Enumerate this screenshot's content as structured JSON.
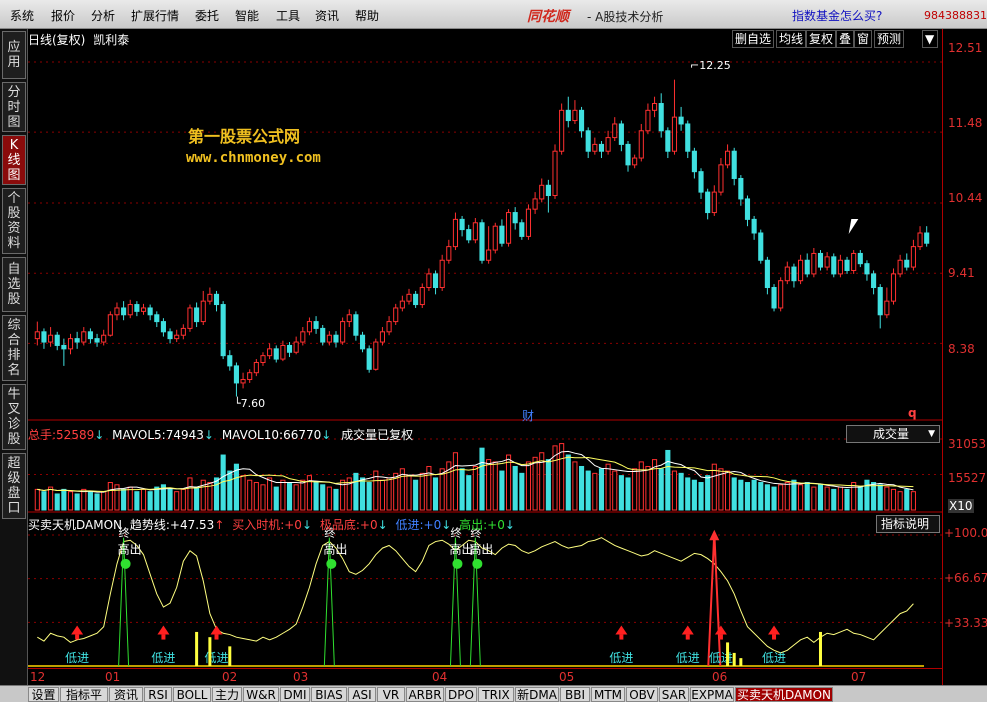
{
  "menu": [
    "系统",
    "报价",
    "分析",
    "扩展行情",
    "委托",
    "智能",
    "工具",
    "资讯",
    "帮助"
  ],
  "brand": "同花顺",
  "app_title": "- A股技术分析",
  "ad_link": "指数基金怎么买?",
  "phone": "984388831",
  "sidebar": [
    {
      "label": "应用",
      "active": false
    },
    {
      "label": "分时图",
      "active": false
    },
    {
      "label": "K线图",
      "active": true
    },
    {
      "label": "个股资料",
      "active": false
    },
    {
      "label": "自选股",
      "active": false
    },
    {
      "label": "综合排名",
      "active": false
    },
    {
      "label": "牛叉诊股",
      "active": false
    },
    {
      "label": "超级盘口",
      "active": false
    }
  ],
  "kline": {
    "period": "日线(复权)",
    "stock": "凯利泰",
    "tools": [
      "删自选",
      "均线",
      "复权",
      "叠",
      "窗",
      "预测"
    ],
    "watermark_cn": "第一股票公式网",
    "watermark_url": "www.chnmoney.com",
    "high_label": "12.25",
    "low_label": "7.60",
    "event_marker": "财",
    "q_marker": "q",
    "axis": [
      "12.51",
      "11.48",
      "10.44",
      "9.41",
      "8.38"
    ],
    "ylim": [
      7.3,
      12.7
    ],
    "colors": {
      "up": "#ff3030",
      "down": "#40e0e0",
      "grid": "#8b0000"
    }
  },
  "volume": {
    "total_label": "总手:",
    "total_value": "52589",
    "mavol5_label": "MAVOL5:",
    "mavol5_value": "74943",
    "mavol10_label": "MAVOL10:",
    "mavol10_value": "66770",
    "note": "成交量已复权",
    "selector": "成交量",
    "axis": [
      "31053",
      "15527",
      "X10"
    ]
  },
  "indicator": {
    "name": "买卖天机DAMON",
    "trend_label": "趋势线:",
    "trend_value": "+47.53",
    "buy_label": "买入时机:",
    "buy_value": "+0",
    "bottom_label": "极品底:",
    "bottom_value": "+0",
    "low_label": "低进:",
    "low_value": "+0",
    "high_label": "高出:",
    "high_value": "+0",
    "button": "指标说明",
    "axis": [
      "+100.0",
      "+66.67",
      "+33.33"
    ],
    "sell_text": "高出",
    "top_text": "终",
    "buy_text": "低进"
  },
  "dates": [
    "12",
    "01",
    "02",
    "03",
    "04",
    "05",
    "06",
    "07"
  ],
  "bottom_tabs": [
    "设置",
    "指标平台",
    "资讯",
    "RSI",
    "BOLL",
    "主力",
    "W&R",
    "DMI",
    "BIAS",
    "ASI",
    "VR",
    "ARBR",
    "DPO",
    "TRIX",
    "新DMA",
    "BBI",
    "MTM",
    "OBV",
    "SAR",
    "EXPMA",
    "买卖天机DAMON"
  ],
  "chart_data": {
    "type": "candlestick",
    "series": [
      {
        "o": 8.45,
        "c": 8.55,
        "h": 8.7,
        "l": 8.35
      },
      {
        "o": 8.55,
        "c": 8.4,
        "h": 8.6,
        "l": 8.3
      },
      {
        "o": 8.4,
        "c": 8.5,
        "h": 8.62,
        "l": 8.33
      },
      {
        "o": 8.5,
        "c": 8.35,
        "h": 8.55,
        "l": 8.28
      },
      {
        "o": 8.35,
        "c": 8.3,
        "h": 8.45,
        "l": 8.05
      },
      {
        "o": 8.3,
        "c": 8.45,
        "h": 8.52,
        "l": 8.22
      },
      {
        "o": 8.45,
        "c": 8.4,
        "h": 8.55,
        "l": 8.3
      },
      {
        "o": 8.4,
        "c": 8.55,
        "h": 8.62,
        "l": 8.35
      },
      {
        "o": 8.55,
        "c": 8.45,
        "h": 8.6,
        "l": 8.38
      },
      {
        "o": 8.45,
        "c": 8.4,
        "h": 8.52,
        "l": 8.33
      },
      {
        "o": 8.4,
        "c": 8.5,
        "h": 8.58,
        "l": 8.35
      },
      {
        "o": 8.5,
        "c": 8.8,
        "h": 8.85,
        "l": 8.48
      },
      {
        "o": 8.8,
        "c": 8.9,
        "h": 8.98,
        "l": 8.72
      },
      {
        "o": 8.9,
        "c": 8.8,
        "h": 9.0,
        "l": 8.72
      },
      {
        "o": 8.8,
        "c": 8.95,
        "h": 9.02,
        "l": 8.75
      },
      {
        "o": 8.95,
        "c": 8.85,
        "h": 9.0,
        "l": 8.78
      },
      {
        "o": 8.85,
        "c": 8.9,
        "h": 8.96,
        "l": 8.8
      },
      {
        "o": 8.9,
        "c": 8.8,
        "h": 8.95,
        "l": 8.72
      },
      {
        "o": 8.8,
        "c": 8.7,
        "h": 8.85,
        "l": 8.62
      },
      {
        "o": 8.7,
        "c": 8.55,
        "h": 8.75,
        "l": 8.48
      },
      {
        "o": 8.55,
        "c": 8.45,
        "h": 8.6,
        "l": 8.38
      },
      {
        "o": 8.45,
        "c": 8.5,
        "h": 8.58,
        "l": 8.4
      },
      {
        "o": 8.5,
        "c": 8.6,
        "h": 8.66,
        "l": 8.44
      },
      {
        "o": 8.6,
        "c": 8.9,
        "h": 8.95,
        "l": 8.55
      },
      {
        "o": 8.9,
        "c": 8.7,
        "h": 8.98,
        "l": 8.62
      },
      {
        "o": 8.7,
        "c": 9.0,
        "h": 9.15,
        "l": 8.65
      },
      {
        "o": 9.0,
        "c": 9.1,
        "h": 9.2,
        "l": 8.95
      },
      {
        "o": 9.1,
        "c": 8.95,
        "h": 9.15,
        "l": 8.85
      },
      {
        "o": 8.95,
        "c": 8.2,
        "h": 9.0,
        "l": 8.15
      },
      {
        "o": 8.2,
        "c": 8.05,
        "h": 8.28,
        "l": 7.98
      },
      {
        "o": 8.05,
        "c": 7.8,
        "h": 8.1,
        "l": 7.6
      },
      {
        "o": 7.8,
        "c": 7.85,
        "h": 7.95,
        "l": 7.72
      },
      {
        "o": 7.85,
        "c": 7.95,
        "h": 8.0,
        "l": 7.8
      },
      {
        "o": 7.95,
        "c": 8.1,
        "h": 8.15,
        "l": 7.9
      },
      {
        "o": 8.1,
        "c": 8.2,
        "h": 8.25,
        "l": 8.05
      },
      {
        "o": 8.2,
        "c": 8.3,
        "h": 8.38,
        "l": 8.15
      },
      {
        "o": 8.3,
        "c": 8.15,
        "h": 8.35,
        "l": 8.1
      },
      {
        "o": 8.15,
        "c": 8.35,
        "h": 8.42,
        "l": 8.12
      },
      {
        "o": 8.35,
        "c": 8.25,
        "h": 8.4,
        "l": 8.18
      },
      {
        "o": 8.25,
        "c": 8.4,
        "h": 8.48,
        "l": 8.22
      },
      {
        "o": 8.4,
        "c": 8.55,
        "h": 8.62,
        "l": 8.35
      },
      {
        "o": 8.55,
        "c": 8.7,
        "h": 8.76,
        "l": 8.5
      },
      {
        "o": 8.7,
        "c": 8.6,
        "h": 8.78,
        "l": 8.52
      },
      {
        "o": 8.6,
        "c": 8.4,
        "h": 8.65,
        "l": 8.35
      },
      {
        "o": 8.4,
        "c": 8.5,
        "h": 8.56,
        "l": 8.35
      },
      {
        "o": 8.5,
        "c": 8.4,
        "h": 8.56,
        "l": 8.32
      },
      {
        "o": 8.4,
        "c": 8.7,
        "h": 8.76,
        "l": 8.36
      },
      {
        "o": 8.7,
        "c": 8.8,
        "h": 8.88,
        "l": 8.62
      },
      {
        "o": 8.8,
        "c": 8.5,
        "h": 8.85,
        "l": 8.42
      },
      {
        "o": 8.5,
        "c": 8.3,
        "h": 8.55,
        "l": 8.25
      },
      {
        "o": 8.3,
        "c": 8.0,
        "h": 8.35,
        "l": 7.95
      },
      {
        "o": 8.0,
        "c": 8.4,
        "h": 8.45,
        "l": 7.98
      },
      {
        "o": 8.4,
        "c": 8.55,
        "h": 8.62,
        "l": 8.35
      },
      {
        "o": 8.55,
        "c": 8.7,
        "h": 8.78,
        "l": 8.5
      },
      {
        "o": 8.7,
        "c": 8.9,
        "h": 8.96,
        "l": 8.65
      },
      {
        "o": 8.9,
        "c": 9.0,
        "h": 9.08,
        "l": 8.85
      },
      {
        "o": 9.0,
        "c": 9.1,
        "h": 9.18,
        "l": 8.95
      },
      {
        "o": 9.1,
        "c": 8.95,
        "h": 9.15,
        "l": 8.9
      },
      {
        "o": 8.95,
        "c": 9.2,
        "h": 9.26,
        "l": 8.9
      },
      {
        "o": 9.2,
        "c": 9.4,
        "h": 9.48,
        "l": 9.15
      },
      {
        "o": 9.4,
        "c": 9.2,
        "h": 9.45,
        "l": 9.1
      },
      {
        "o": 9.2,
        "c": 9.6,
        "h": 9.68,
        "l": 9.15
      },
      {
        "o": 9.6,
        "c": 9.8,
        "h": 9.9,
        "l": 9.55
      },
      {
        "o": 9.8,
        "c": 10.2,
        "h": 10.3,
        "l": 9.75
      },
      {
        "o": 10.2,
        "c": 10.05,
        "h": 10.25,
        "l": 9.95
      },
      {
        "o": 10.05,
        "c": 9.9,
        "h": 10.12,
        "l": 9.85
      },
      {
        "o": 9.9,
        "c": 10.15,
        "h": 10.22,
        "l": 9.85
      },
      {
        "o": 10.15,
        "c": 9.6,
        "h": 10.2,
        "l": 9.55
      },
      {
        "o": 9.6,
        "c": 9.75,
        "h": 10.1,
        "l": 9.55
      },
      {
        "o": 9.75,
        "c": 10.1,
        "h": 10.15,
        "l": 9.7
      },
      {
        "o": 10.1,
        "c": 9.85,
        "h": 10.2,
        "l": 9.8
      },
      {
        "o": 9.85,
        "c": 10.3,
        "h": 10.35,
        "l": 9.8
      },
      {
        "o": 10.3,
        "c": 10.15,
        "h": 10.38,
        "l": 10.05
      },
      {
        "o": 10.15,
        "c": 9.95,
        "h": 10.2,
        "l": 9.9
      },
      {
        "o": 9.95,
        "c": 10.35,
        "h": 10.42,
        "l": 9.9
      },
      {
        "o": 10.35,
        "c": 10.5,
        "h": 10.6,
        "l": 10.28
      },
      {
        "o": 10.5,
        "c": 10.7,
        "h": 10.8,
        "l": 10.45
      },
      {
        "o": 10.7,
        "c": 10.55,
        "h": 10.78,
        "l": 10.3
      },
      {
        "o": 10.55,
        "c": 11.2,
        "h": 11.3,
        "l": 10.5
      },
      {
        "o": 11.2,
        "c": 11.8,
        "h": 11.9,
        "l": 11.15
      },
      {
        "o": 11.8,
        "c": 11.65,
        "h": 12.0,
        "l": 11.55
      },
      {
        "o": 11.65,
        "c": 11.8,
        "h": 11.95,
        "l": 11.6
      },
      {
        "o": 11.8,
        "c": 11.5,
        "h": 11.85,
        "l": 11.4
      },
      {
        "o": 11.5,
        "c": 11.2,
        "h": 11.55,
        "l": 11.1
      },
      {
        "o": 11.2,
        "c": 11.3,
        "h": 11.4,
        "l": 11.15
      },
      {
        "o": 11.3,
        "c": 11.2,
        "h": 11.35,
        "l": 11.1
      },
      {
        "o": 11.2,
        "c": 11.4,
        "h": 11.5,
        "l": 11.15
      },
      {
        "o": 11.4,
        "c": 11.6,
        "h": 11.7,
        "l": 11.35
      },
      {
        "o": 11.6,
        "c": 11.3,
        "h": 11.65,
        "l": 11.2
      },
      {
        "o": 11.3,
        "c": 11.0,
        "h": 11.35,
        "l": 10.9
      },
      {
        "o": 11.0,
        "c": 11.1,
        "h": 11.15,
        "l": 10.95
      },
      {
        "o": 11.1,
        "c": 11.5,
        "h": 11.6,
        "l": 11.05
      },
      {
        "o": 11.5,
        "c": 11.8,
        "h": 11.9,
        "l": 11.45
      },
      {
        "o": 11.8,
        "c": 11.9,
        "h": 12.0,
        "l": 11.7
      },
      {
        "o": 11.9,
        "c": 11.5,
        "h": 12.05,
        "l": 11.4
      },
      {
        "o": 11.5,
        "c": 11.2,
        "h": 11.55,
        "l": 11.1
      },
      {
        "o": 11.2,
        "c": 11.7,
        "h": 12.25,
        "l": 11.15
      },
      {
        "o": 11.7,
        "c": 11.6,
        "h": 11.85,
        "l": 11.5
      },
      {
        "o": 11.6,
        "c": 11.2,
        "h": 11.65,
        "l": 11.1
      },
      {
        "o": 11.2,
        "c": 10.9,
        "h": 11.25,
        "l": 10.8
      },
      {
        "o": 10.9,
        "c": 10.6,
        "h": 10.95,
        "l": 10.5
      },
      {
        "o": 10.6,
        "c": 10.3,
        "h": 10.65,
        "l": 10.2
      },
      {
        "o": 10.3,
        "c": 10.6,
        "h": 10.7,
        "l": 10.25
      },
      {
        "o": 10.6,
        "c": 11.0,
        "h": 11.1,
        "l": 10.55
      },
      {
        "o": 11.0,
        "c": 11.2,
        "h": 11.3,
        "l": 10.95
      },
      {
        "o": 11.2,
        "c": 10.8,
        "h": 11.25,
        "l": 10.7
      },
      {
        "o": 10.8,
        "c": 10.5,
        "h": 10.85,
        "l": 10.4
      },
      {
        "o": 10.5,
        "c": 10.2,
        "h": 10.55,
        "l": 10.1
      },
      {
        "o": 10.2,
        "c": 10.0,
        "h": 10.25,
        "l": 9.9
      },
      {
        "o": 10.0,
        "c": 9.6,
        "h": 10.05,
        "l": 9.55
      },
      {
        "o": 9.6,
        "c": 9.2,
        "h": 9.65,
        "l": 9.1
      },
      {
        "o": 9.2,
        "c": 8.9,
        "h": 9.25,
        "l": 8.85
      },
      {
        "o": 8.9,
        "c": 9.3,
        "h": 9.35,
        "l": 8.85
      },
      {
        "o": 9.3,
        "c": 9.5,
        "h": 9.58,
        "l": 9.25
      },
      {
        "o": 9.5,
        "c": 9.3,
        "h": 9.55,
        "l": 9.2
      },
      {
        "o": 9.3,
        "c": 9.6,
        "h": 9.68,
        "l": 9.25
      },
      {
        "o": 9.6,
        "c": 9.4,
        "h": 9.7,
        "l": 9.35
      },
      {
        "o": 9.4,
        "c": 9.7,
        "h": 9.78,
        "l": 9.35
      },
      {
        "o": 9.7,
        "c": 9.5,
        "h": 9.75,
        "l": 9.45
      },
      {
        "o": 9.5,
        "c": 9.65,
        "h": 9.72,
        "l": 9.45
      },
      {
        "o": 9.65,
        "c": 9.4,
        "h": 9.7,
        "l": 9.35
      },
      {
        "o": 9.4,
        "c": 9.6,
        "h": 9.68,
        "l": 9.35
      },
      {
        "o": 9.6,
        "c": 9.45,
        "h": 9.65,
        "l": 9.4
      },
      {
        "o": 9.45,
        "c": 9.7,
        "h": 9.75,
        "l": 9.4
      },
      {
        "o": 9.7,
        "c": 9.55,
        "h": 9.75,
        "l": 9.5
      },
      {
        "o": 9.55,
        "c": 9.4,
        "h": 9.6,
        "l": 9.3
      },
      {
        "o": 9.4,
        "c": 9.2,
        "h": 9.45,
        "l": 9.1
      },
      {
        "o": 9.2,
        "c": 8.8,
        "h": 9.25,
        "l": 8.6
      },
      {
        "o": 8.8,
        "c": 9.0,
        "h": 9.2,
        "l": 8.75
      },
      {
        "o": 9.0,
        "c": 9.4,
        "h": 9.48,
        "l": 8.95
      },
      {
        "o": 9.4,
        "c": 9.6,
        "h": 9.68,
        "l": 9.35
      },
      {
        "o": 9.6,
        "c": 9.5,
        "h": 9.7,
        "l": 9.45
      },
      {
        "o": 9.5,
        "c": 9.8,
        "h": 9.9,
        "l": 9.45
      },
      {
        "o": 9.8,
        "c": 10.0,
        "h": 10.1,
        "l": 9.75
      },
      {
        "o": 10.0,
        "c": 9.85,
        "h": 10.1,
        "l": 9.8
      }
    ],
    "volume": [
      9,
      8,
      10,
      7,
      9,
      8,
      7,
      9,
      8,
      7,
      8,
      12,
      11,
      9,
      10,
      8,
      9,
      8,
      10,
      11,
      9,
      8,
      9,
      14,
      10,
      13,
      12,
      14,
      24,
      17,
      20,
      15,
      13,
      12,
      11,
      14,
      10,
      13,
      12,
      11,
      13,
      15,
      12,
      11,
      10,
      9,
      13,
      14,
      16,
      14,
      12,
      17,
      13,
      14,
      16,
      18,
      15,
      13,
      16,
      19,
      14,
      18,
      21,
      25,
      18,
      15,
      19,
      27,
      22,
      21,
      17,
      24,
      19,
      16,
      21,
      23,
      25,
      22,
      28,
      29,
      24,
      21,
      19,
      17,
      16,
      18,
      20,
      17,
      15,
      14,
      18,
      21,
      19,
      22,
      18,
      26,
      17,
      16,
      14,
      13,
      12,
      15,
      20,
      18,
      17,
      14,
      13,
      12,
      13,
      12,
      11,
      10,
      11,
      12,
      13,
      11,
      12,
      10,
      11,
      10,
      9,
      10,
      9,
      12,
      10,
      13,
      12,
      11,
      10,
      9,
      8,
      9,
      8
    ],
    "indicator": [
      22,
      19,
      25,
      23,
      22,
      18,
      20,
      21,
      23,
      25,
      30,
      55,
      78,
      95,
      96,
      92,
      85,
      70,
      55,
      45,
      48,
      60,
      80,
      88,
      84,
      65,
      40,
      28,
      25,
      24,
      22,
      21,
      20,
      19,
      22,
      20,
      22,
      25,
      28,
      32,
      45,
      60,
      78,
      92,
      95,
      90,
      82,
      72,
      70,
      73,
      78,
      85,
      90,
      92,
      88,
      82,
      76,
      72,
      80,
      92,
      95,
      96,
      93,
      88,
      92,
      96,
      95,
      90,
      88,
      85,
      90,
      93,
      92,
      88,
      86,
      88,
      91,
      93,
      95,
      92,
      90,
      91,
      92,
      95,
      96,
      98,
      95,
      92,
      90,
      88,
      86,
      84,
      85,
      88,
      86,
      84,
      82,
      80,
      83,
      86,
      85,
      82,
      78,
      72,
      65,
      55,
      42,
      30,
      25,
      20,
      15,
      12,
      10,
      12,
      16,
      20,
      22,
      18,
      22,
      25,
      24,
      26,
      28,
      25,
      24,
      22,
      20,
      25,
      30,
      35,
      40,
      42,
      47.53
    ]
  }
}
